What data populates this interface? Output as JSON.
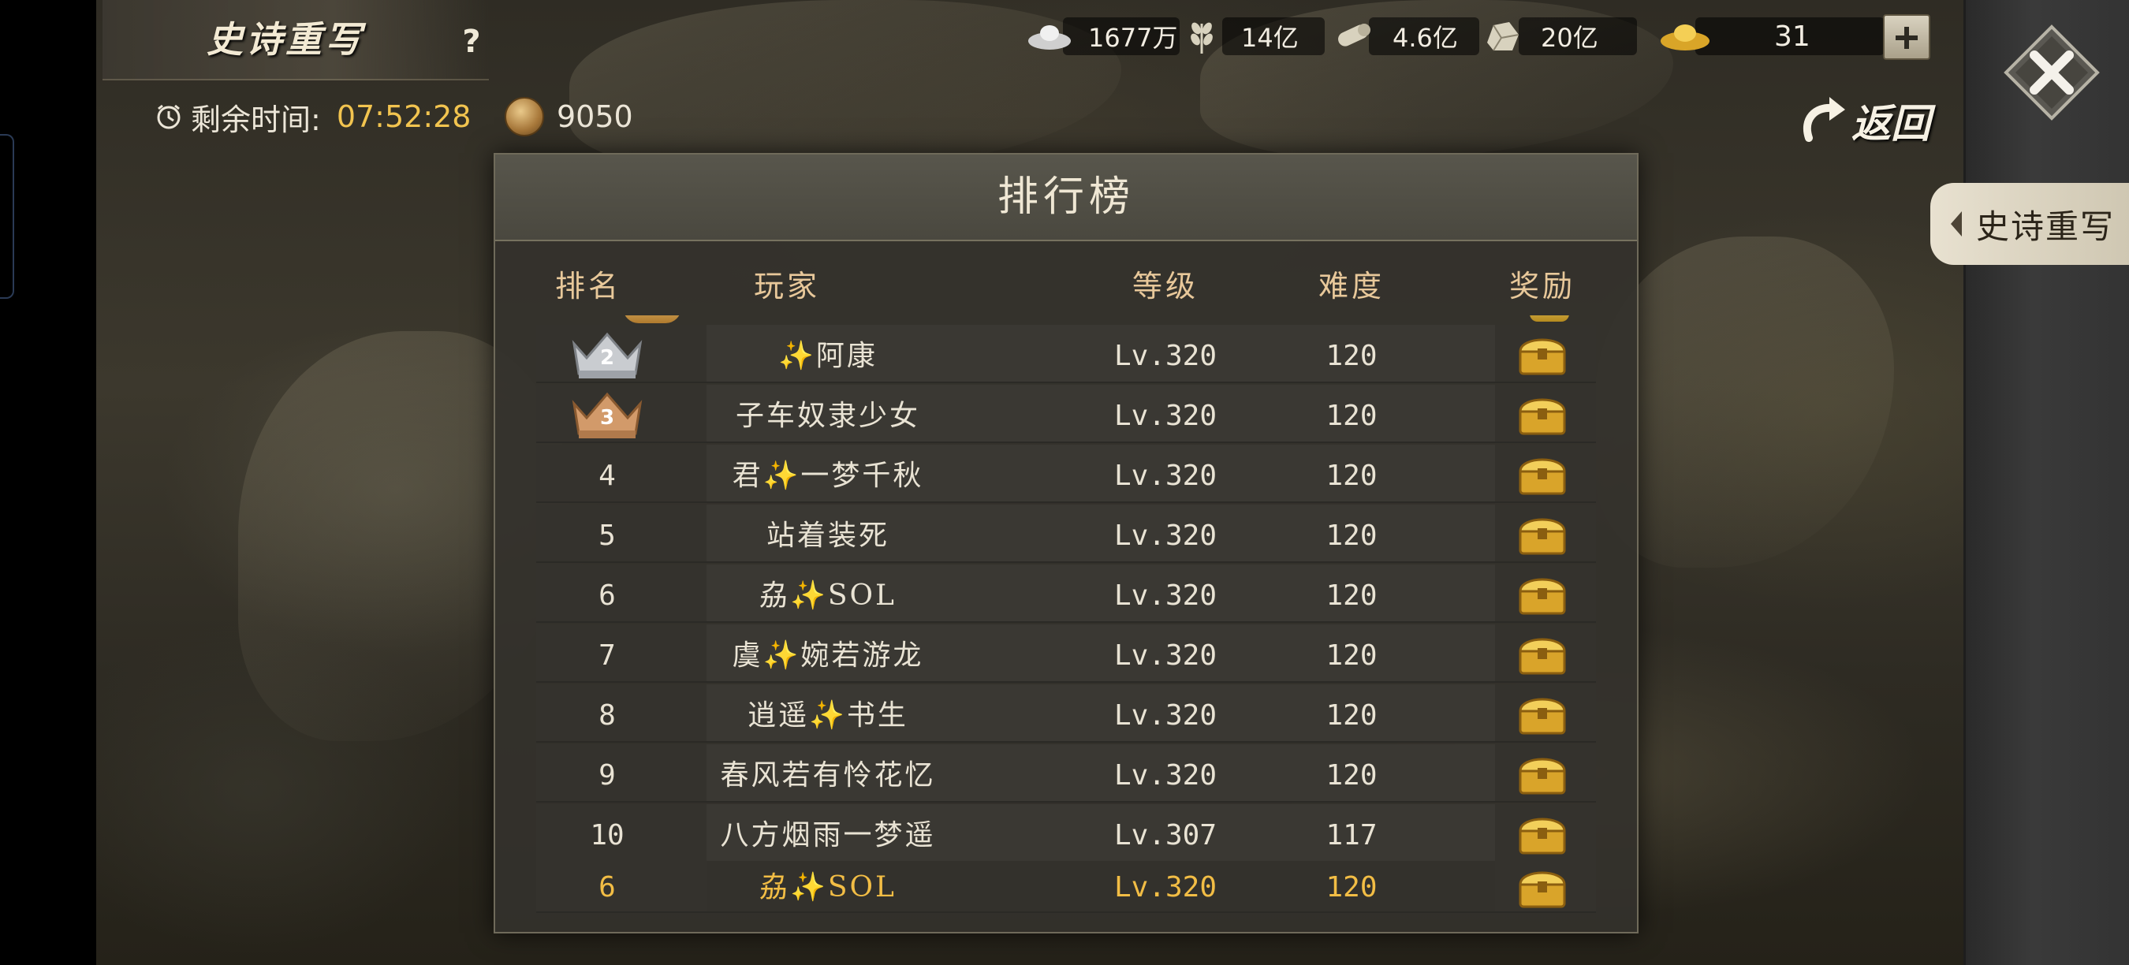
{
  "header": {
    "title": "史诗重写",
    "help_label": "?",
    "timer_label": "剩余时间:",
    "timer_value": "07:52:28",
    "coins": "9050"
  },
  "resources": [
    {
      "icon": "silver-ingot-icon",
      "value": "1677万"
    },
    {
      "icon": "grain-icon",
      "value": "14亿"
    },
    {
      "icon": "wood-log-icon",
      "value": "4.6亿"
    },
    {
      "icon": "stone-icon",
      "value": "20亿"
    },
    {
      "icon": "gold-ingot-icon",
      "value": "31"
    }
  ],
  "nav": {
    "back_label": "返回",
    "side_tab_label": "史诗重写"
  },
  "leaderboard": {
    "title": "排行榜",
    "columns": {
      "rank": "排名",
      "player": "玩家",
      "level": "等级",
      "difficulty": "难度",
      "reward": "奖励"
    },
    "rows": [
      {
        "rank": "2",
        "player": "✨阿康",
        "level": "Lv.320",
        "difficulty": "120"
      },
      {
        "rank": "3",
        "player": "子车奴隶少女",
        "level": "Lv.320",
        "difficulty": "120"
      },
      {
        "rank": "4",
        "player": "君✨一梦千秋",
        "level": "Lv.320",
        "difficulty": "120"
      },
      {
        "rank": "5",
        "player": "站着装死",
        "level": "Lv.320",
        "difficulty": "120"
      },
      {
        "rank": "6",
        "player": "劦✨SOL",
        "level": "Lv.320",
        "difficulty": "120"
      },
      {
        "rank": "7",
        "player": "虞✨婉若游龙",
        "level": "Lv.320",
        "difficulty": "120"
      },
      {
        "rank": "8",
        "player": "逍遥✨书生",
        "level": "Lv.320",
        "difficulty": "120"
      },
      {
        "rank": "9",
        "player": "春风若有怜花忆",
        "level": "Lv.320",
        "difficulty": "120"
      },
      {
        "rank": "10",
        "player": "八方烟雨一梦遥",
        "level": "Lv.307",
        "difficulty": "117"
      }
    ],
    "my_row": {
      "rank": "6",
      "player": "劦✨SOL",
      "level": "Lv.320",
      "difficulty": "120"
    }
  },
  "colors": {
    "accent_gold": "#f2c44f",
    "my_row_text": "#f2bd45",
    "header_text": "#e8c89a"
  }
}
